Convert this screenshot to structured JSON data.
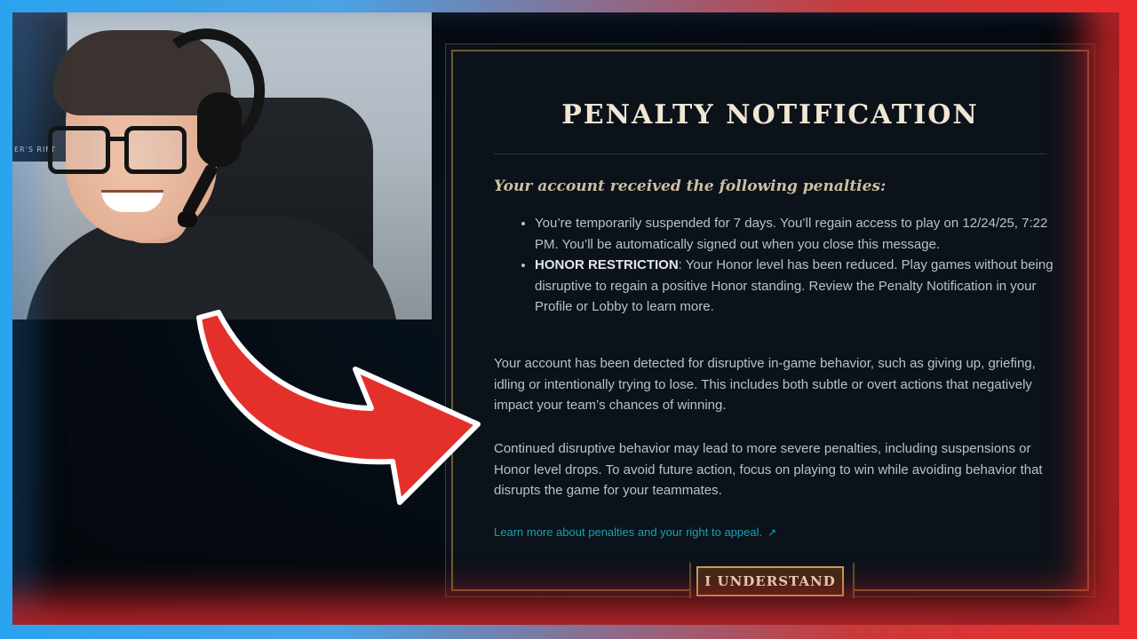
{
  "webcam": {
    "poster_text": "ER'S RIFT"
  },
  "notification": {
    "title": "PENALTY NOTIFICATION",
    "subtitle": "Your account received the following penalties:",
    "penalties": [
      {
        "text": "You’re temporarily suspended for 7 days. You’ll regain access to play on 12/24/25, 7:22 PM. You’ll be automatically signed out when you close this message."
      },
      {
        "label": "HONOR RESTRICTION",
        "text": ": Your Honor level has been reduced. Play games without being disruptive to regain a positive Honor standing. Review the Penalty Notification in your Profile or Lobby to learn more."
      }
    ],
    "paragraph_1": "Your account has been detected for disruptive in-game behavior, such as giving up, griefing, idling or intentionally trying to lose. This includes both subtle or overt actions that negatively impact your team’s chances of winning.",
    "paragraph_2": "Continued disruptive behavior may lead to more severe penalties, including suspensions or Honor level drops. To avoid future action, focus on playing to win while avoiding behavior that disrupts the game for your teammates.",
    "appeal_link": "Learn more about penalties and your right to appeal.",
    "appeal_link_icon": "↗",
    "button_label": "I UNDERSTAND"
  },
  "colors": {
    "title": "#f0e6d2",
    "link": "#16a2b4",
    "gold_border": "#c59e58",
    "arrow": "#e4302b"
  }
}
